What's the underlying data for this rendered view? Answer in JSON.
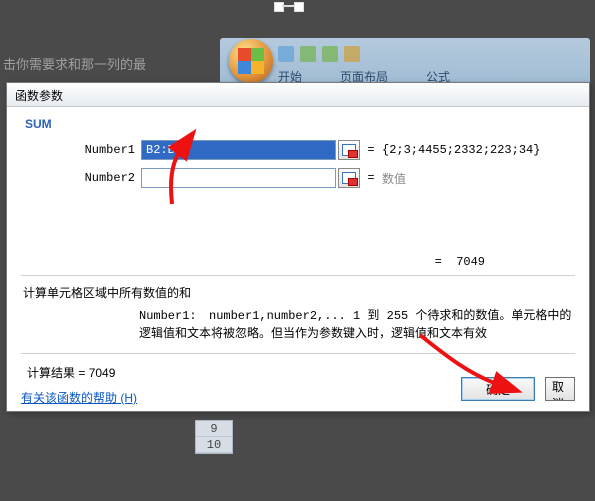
{
  "background": {
    "hint_text": "击你需要求和那一列的最",
    "ribbon_tabs": [
      "开始",
      "",
      "",
      "页面布局",
      "公式"
    ]
  },
  "dialog": {
    "title": "函数参数",
    "function_name": "SUM",
    "args": [
      {
        "label": "Number1",
        "value": "B2:B7",
        "preview": "{2;3;4455;2332;223;34}",
        "placeholder": ""
      },
      {
        "label": "Number2",
        "value": "",
        "preview": "数值",
        "placeholder": ""
      }
    ],
    "intermediate_result_label": "=",
    "intermediate_result": "7049",
    "description": "计算单元格区域中所有数值的和",
    "arg_help_label": "Number1:",
    "arg_help_text": "number1,number2,... 1 到 255 个待求和的数值。单元格中的逻辑值和文本将被忽略。但当作为参数键入时，逻辑值和文本有效",
    "calc_result_label": "计算结果 =",
    "calc_result": "7049",
    "help_link": "有关该函数的帮助 (H)",
    "ok_button": "确定",
    "cancel_button": "取消"
  },
  "rownums": [
    "9",
    "10"
  ]
}
